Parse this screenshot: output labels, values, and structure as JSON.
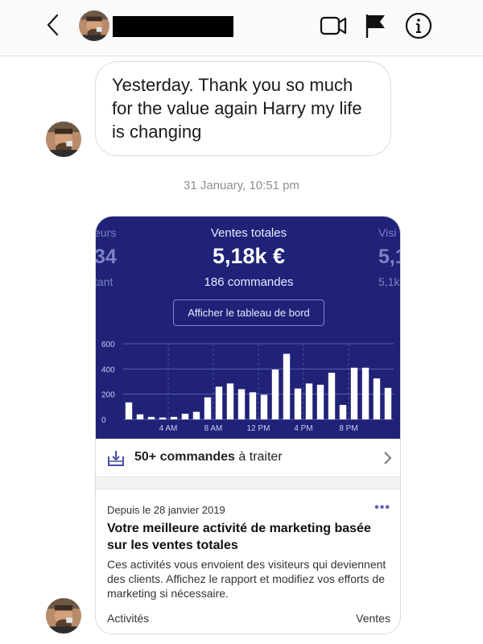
{
  "header": {
    "icons": [
      "back-icon",
      "video-call-icon",
      "flag-icon",
      "info-icon"
    ]
  },
  "message": {
    "text": "Yesterday. Thank you so much for the value again Harry my life is changing"
  },
  "timestamp": "31 January, 10:51 pm",
  "card": {
    "left_partial": {
      "label": "eurs",
      "value": "34",
      "sub": "tant"
    },
    "center": {
      "label": "Ventes totales",
      "value": "5,18k €",
      "orders": "186 commandes",
      "button": "Afficher le tableau de bord"
    },
    "right_partial": {
      "label": "Visi",
      "value": "5,1",
      "sub": "5,1k"
    },
    "orders_row": {
      "strong": "50+ commandes",
      "rest": " à traiter"
    },
    "activity": {
      "date": "Depuis le 28 janvier 2019",
      "more": "•••",
      "title": "Votre meilleure activité de marketing basée sur les ventes totales",
      "description": "Ces activités vous envoient des visiteurs qui deviennent des clients. Affichez le rapport et modifiez vos efforts de marketing si nécessaire.",
      "footer_left": "Activités",
      "footer_right": "Ventes"
    }
  },
  "chart_data": {
    "type": "bar",
    "y_ticks": [
      "600",
      "400",
      "200",
      "0"
    ],
    "ylim": [
      0,
      600
    ],
    "x_ticks": [
      {
        "index": 3.5,
        "label": "4 AM"
      },
      {
        "index": 7.5,
        "label": "8 AM"
      },
      {
        "index": 11.5,
        "label": "12 PM"
      },
      {
        "index": 15.5,
        "label": "4 PM"
      },
      {
        "index": 19.5,
        "label": "8 PM"
      }
    ],
    "values": [
      135,
      40,
      20,
      15,
      20,
      45,
      60,
      175,
      260,
      285,
      240,
      215,
      195,
      395,
      520,
      245,
      285,
      275,
      370,
      115,
      410,
      410,
      325,
      250
    ],
    "colors": {
      "background": "#1f2277",
      "bar": "#ffffff",
      "grid": "#5a5fb0",
      "dashed": "#4d52a3",
      "tick": "#c9ccf2"
    }
  }
}
